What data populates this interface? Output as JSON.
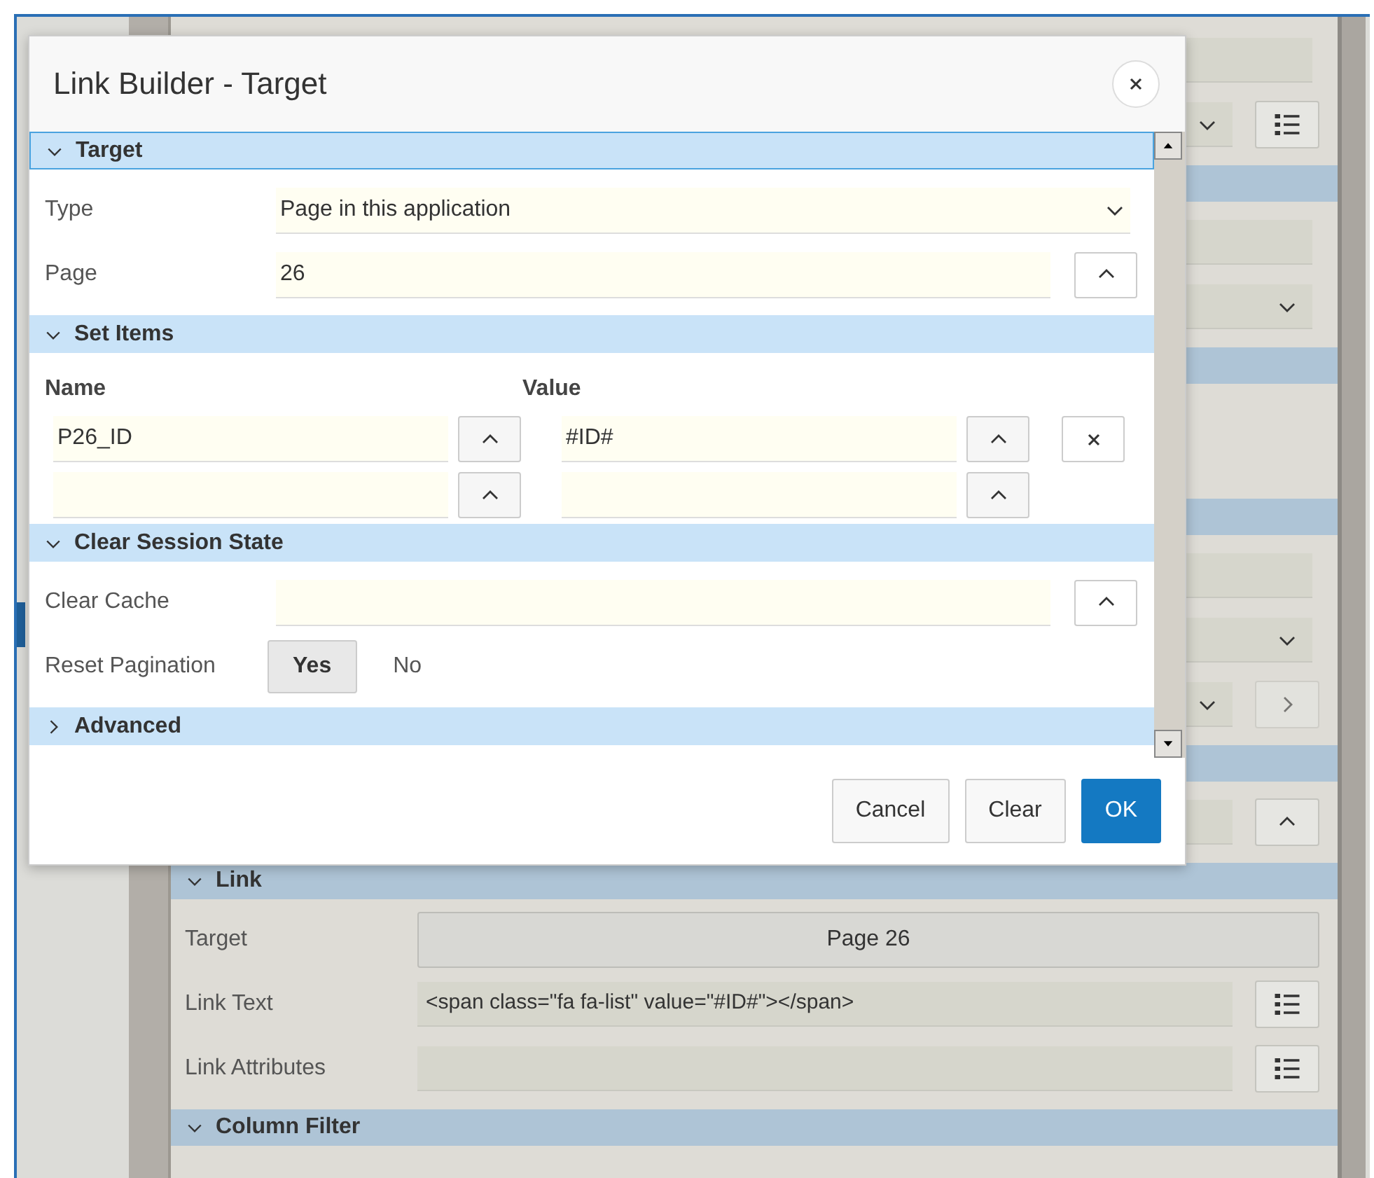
{
  "dialog": {
    "title": "Link Builder - Target",
    "sections": [
      {
        "kind": "fields",
        "title": "Target",
        "expanded": true,
        "fields": [
          {
            "kind": "select",
            "label": "Type",
            "value": "Page in this application"
          },
          {
            "kind": "popup",
            "label": "Page",
            "value": "26"
          }
        ]
      },
      {
        "kind": "items",
        "title": "Set Items",
        "expanded": true,
        "columns": [
          "Name",
          "Value"
        ],
        "rows": [
          {
            "name": "P26_ID",
            "value": "#ID#",
            "removable": true
          },
          {
            "removable": false
          }
        ]
      },
      {
        "kind": "fields",
        "title": "Clear Session State",
        "expanded": true,
        "fields": [
          {
            "kind": "popup",
            "label": "Clear Cache"
          },
          {
            "kind": "toggle",
            "label": "Reset Pagination",
            "options": [
              {
                "label": "Yes",
                "selected": true
              },
              {
                "label": "No",
                "selected": false
              }
            ]
          }
        ]
      },
      {
        "title": "Advanced",
        "expanded": false
      }
    ],
    "buttons": [
      {
        "label": "Cancel",
        "kind": "default"
      },
      {
        "label": "Clear",
        "kind": "default"
      },
      {
        "label": "OK",
        "kind": "primary"
      }
    ]
  },
  "background": {
    "sections": [
      {
        "title": "Link",
        "expanded": true,
        "fields": [
          {
            "kind": "button",
            "label": "Target",
            "value": "Page 26"
          },
          {
            "kind": "list",
            "label": "Link Text",
            "value": "<span class=\"fa fa-list\" value=\"#ID#\"></span>"
          },
          {
            "kind": "list",
            "label": "Link Attributes"
          }
        ]
      },
      {
        "title": "Column Filter",
        "expanded": true
      }
    ]
  }
}
